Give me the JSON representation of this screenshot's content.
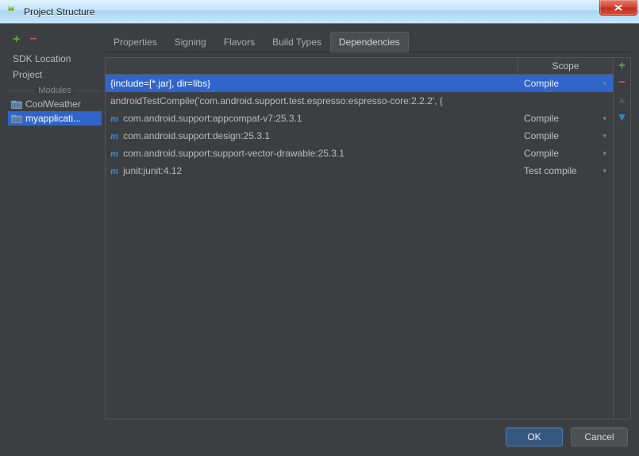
{
  "window": {
    "title": "Project Structure"
  },
  "sidebar": {
    "items": [
      {
        "label": "SDK Location"
      },
      {
        "label": "Project"
      }
    ],
    "modules_label": "Modules",
    "modules": [
      {
        "label": "CoolWeather",
        "selected": false
      },
      {
        "label": "myapplicati...",
        "selected": true
      }
    ]
  },
  "tabs": [
    {
      "label": "Properties",
      "active": false
    },
    {
      "label": "Signing",
      "active": false
    },
    {
      "label": "Flavors",
      "active": false
    },
    {
      "label": "Build Types",
      "active": false
    },
    {
      "label": "Dependencies",
      "active": true
    }
  ],
  "dependencies": {
    "scope_header": "Scope",
    "rows": [
      {
        "icon": "none",
        "text": "{include=[*.jar], dir=libs}",
        "scope": "Compile",
        "selected": true,
        "scope_visible": true
      },
      {
        "icon": "none",
        "text": "androidTestCompile('com.android.support.test.espresso:espresso-core:2.2.2', {",
        "scope": "",
        "selected": false,
        "scope_visible": false
      },
      {
        "icon": "m",
        "text": "com.android.support:appcompat-v7:25.3.1",
        "scope": "Compile",
        "selected": false,
        "scope_visible": true
      },
      {
        "icon": "m",
        "text": "com.android.support:design:25.3.1",
        "scope": "Compile",
        "selected": false,
        "scope_visible": true
      },
      {
        "icon": "m",
        "text": "com.android.support:support-vector-drawable:25.3.1",
        "scope": "Compile",
        "selected": false,
        "scope_visible": true
      },
      {
        "icon": "m",
        "text": "junit:junit:4.12",
        "scope": "Test compile",
        "selected": false,
        "scope_visible": true
      }
    ]
  },
  "buttons": {
    "ok": "OK",
    "cancel": "Cancel"
  }
}
